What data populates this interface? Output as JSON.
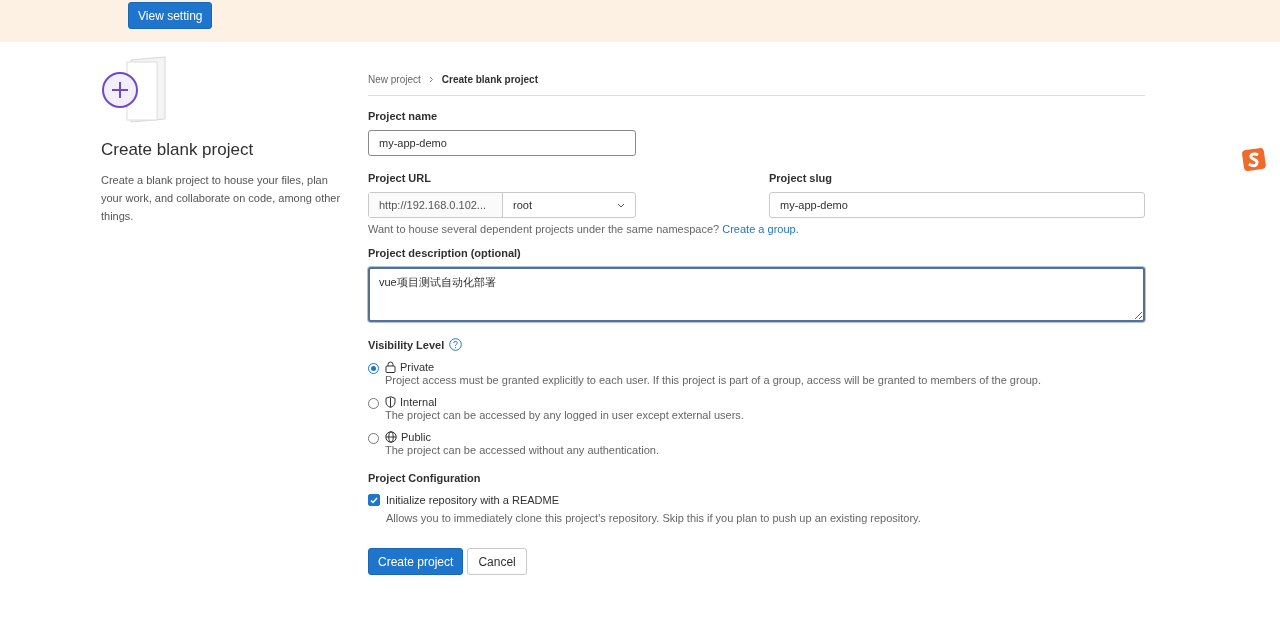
{
  "banner": {
    "button": "View setting"
  },
  "intro": {
    "title": "Create blank project",
    "text": "Create a blank project to house your files, plan your work, and collaborate on code, among other things."
  },
  "breadcrumb": [
    {
      "label": "New project",
      "current": false
    },
    {
      "label": "Create blank project",
      "current": true
    }
  ],
  "project_name": {
    "label": "Project name",
    "value": "my-app-demo"
  },
  "project_url": {
    "label": "Project URL",
    "prefix": "http://192.168.0.102...",
    "namespace": "root"
  },
  "project_slug": {
    "label": "Project slug",
    "value": "my-app-demo"
  },
  "namespace_hint": {
    "text": "Want to house several dependent projects under the same namespace?",
    "link": "Create a group."
  },
  "description": {
    "label": "Project description (optional)",
    "value": "vue项目测试自动化部署"
  },
  "visibility": {
    "label": "Visibility Level",
    "options": [
      {
        "kind": "private",
        "label": "Private",
        "help": "Project access must be granted explicitly to each user. If this project is part of a group, access will be granted to members of the group.",
        "selected": true
      },
      {
        "kind": "internal",
        "label": "Internal",
        "help": "The project can be accessed by any logged in user except external users.",
        "selected": false
      },
      {
        "kind": "public",
        "label": "Public",
        "help": "The project can be accessed without any authentication.",
        "selected": false
      }
    ]
  },
  "configuration": {
    "label": "Project Configuration",
    "option": {
      "label": "Initialize repository with a README",
      "help": "Allows you to immediately clone this project's repository. Skip this if you plan to push up an existing repository.",
      "checked": true
    }
  },
  "actions": {
    "primary": "Create project",
    "secondary": "Cancel"
  }
}
